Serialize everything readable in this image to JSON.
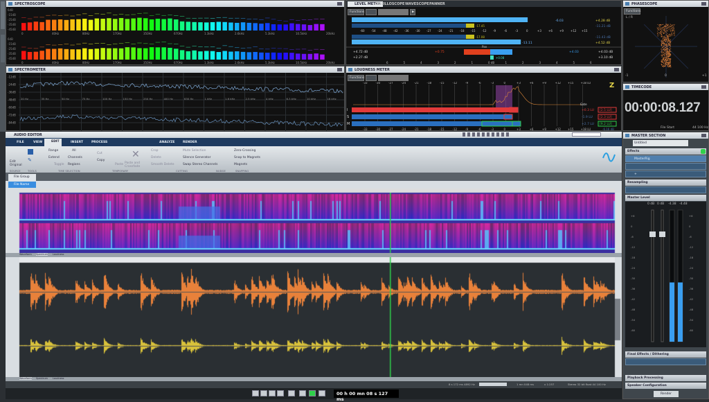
{
  "left_strip": {
    "tabs": [
      "Spectroscope",
      "Spectrometer"
    ]
  },
  "spectroscope": {
    "title": "SPECTROSCOPE",
    "db_ticks": [
      "6dB",
      "-15dB",
      "-25dB",
      "-35dB",
      "-45dB"
    ],
    "freq_ticks": [
      "0",
      "40Hz",
      "80Hz",
      "170Hz",
      "350Hz",
      "670Hz",
      "1.3kHz",
      "2.6kHz",
      "5.3kHz",
      "10.5kHz",
      "20kHz"
    ]
  },
  "spectrometer": {
    "title": "SPECTROMETER",
    "db_ticks": [
      "-12dB",
      "-24dB",
      "-36dB",
      "-48dB",
      "-60dB",
      "-72dB",
      "-84dB"
    ],
    "freq_ticks": [
      "20 Hz",
      "35 Hz",
      "50 Hz",
      "75 Hz",
      "100 Hz",
      "150 Hz",
      "250 Hz",
      "400 Hz",
      "630 Hz",
      "1 kHz",
      "1.6 kHz",
      "2.5 kHz",
      "4 kHz",
      "6.3 kHz",
      "10 kHz",
      "16 kHz"
    ]
  },
  "level_meter": {
    "tabs": [
      "LEVEL METER",
      "OSCILLOSCOPE",
      "WAVESCOPE",
      "PANNER"
    ],
    "functions_label": "Functions",
    "scale": [
      "-60",
      "-54",
      "-48",
      "-42",
      "-36",
      "-30",
      "-27",
      "-24",
      "-21",
      "-18",
      "-15",
      "-12",
      "-9",
      "-6",
      "-3",
      "0",
      "+3",
      "+6",
      "+9",
      "+12",
      "+15"
    ],
    "left": {
      "peak": "-6.03",
      "rms": "-17.45",
      "max_peak": "+4.28 dB",
      "max_rms": "-11.21 dB",
      "level": 0.77
    },
    "right": {
      "peak": "-13.11",
      "rms": "-17.08",
      "max_peak": "+4.52 dB",
      "max_rms": "-11.43 dB",
      "level": 0.74
    },
    "pan": {
      "label": "Pan",
      "left_top": "+4.72 dB",
      "left_bottom": "+2.27 dB",
      "left_val": "+0.75",
      "right_val": "+4.03",
      "right_top": "+4.03 dB",
      "right_bottom": "+3.10 dB",
      "center_val": "+0.08",
      "center": "0 dB",
      "scale": [
        "6",
        "5",
        "4",
        "3",
        "2",
        "1",
        "0 dB",
        "1",
        "2",
        "3",
        "4",
        "5",
        "6"
      ]
    }
  },
  "loudness_meter": {
    "title": "LOUDNESS METER",
    "functions_label": "Functions",
    "scale": [
      "-33",
      "-30",
      "-27",
      "-24",
      "-21",
      "-18",
      "-15",
      "-12",
      "-9",
      "-6",
      "-3",
      "0",
      "+3",
      "+6",
      "+9",
      "+12",
      "+15",
      "+18 LU"
    ],
    "rows": [
      {
        "label": "I",
        "value": "+0.3 LU",
        "max": "[2.5 LU]",
        "color": "#e23a3a"
      },
      {
        "label": "S",
        "value": "-1.9 LU",
        "max": "[2.3 LU]",
        "color": "#2a6fbf"
      },
      {
        "label": "M",
        "value": "+2.7 LU",
        "max": "[9.2 LU]",
        "color": "#2a6fbf"
      }
    ],
    "gate_label": "Gate",
    "tp_value": "-6.16 dB"
  },
  "phasescope": {
    "title": "PHASESCOPE",
    "functions_label": "Functions",
    "lr_label": "L / R",
    "bottom_left": "-1",
    "bottom_center": "0",
    "bottom_right": "+1"
  },
  "timecode": {
    "title": "TIMECODE",
    "time": "00:00:08.127",
    "mode": "File Start",
    "rate": "44 100 Hz"
  },
  "audio_editor": {
    "title": "AUDIO EDITOR",
    "tabs": [
      "FILE",
      "VIEW",
      "EDIT",
      "INSERT",
      "PROCESS",
      "ANALYZE",
      "RENDER"
    ],
    "active_tab": "EDIT",
    "ribbon": {
      "groups": [
        "SOURCE",
        "TOOLS",
        "TIME SELECTION",
        "TEMPORARY",
        "CUTTING",
        "NUDGE",
        "SNAPPING"
      ],
      "source": [
        "Edit Original"
      ],
      "time_selection": [
        "Range",
        "Extend",
        "Toggle",
        "All",
        "Channels",
        "Regions"
      ],
      "temporary": [
        "Cut",
        "Copy",
        "Paste",
        "Delete",
        "Paste and Crossfade"
      ],
      "cutting": [
        "Crop",
        "Delete",
        "Smooth Delete",
        "Mute Selection",
        "Silence Generator",
        "Swap Stereo Channels"
      ],
      "snapping": [
        "Zero-Crossing",
        "Snap to Magnets",
        "Magnets"
      ]
    },
    "file_group": "File Group",
    "file_tab": "File Name",
    "spectrum_tabs": [
      "Waveform",
      "Spectrum",
      "Loudness"
    ],
    "wave_tabs": [
      "Waveform",
      "Spectrum",
      "Loudness"
    ],
    "status": {
      "cursor": "8 s 172 ms  4892 Hz",
      "length": "1 mn 048 ms",
      "zoom": "x 1:257",
      "format": "Stereo 32 bit float 44 100 Hz"
    }
  },
  "transport": {
    "time": "00 h 00 mn 08 s 127 ms"
  },
  "master_section": {
    "title": "MASTER SECTION",
    "preset": "Untitled",
    "effects_label": "Effects",
    "effect_slots": [
      "MasterRig",
      "",
      ""
    ],
    "resampling_label": "Resampling",
    "master_level_label": "Master Level",
    "levels": [
      "0 dB",
      "0 dB",
      "-4.38",
      "-4.48"
    ],
    "meter_left": 0.45,
    "meter_right": 0.45,
    "fader_scale": [
      "+6",
      "0",
      "-6",
      "-12",
      "-18",
      "-24",
      "-30",
      "-36",
      "-42",
      "-48",
      "-54",
      "-60"
    ],
    "sections": [
      "Final Effects / Dithering",
      "Playback Processing",
      "Speaker Configuration"
    ],
    "render_label": "Render"
  },
  "colors": {
    "accent": "#3aa0e8",
    "orange_wave": "#e8813a",
    "yellow_wave": "#d9c23a",
    "cursor": "#2fd04a"
  }
}
